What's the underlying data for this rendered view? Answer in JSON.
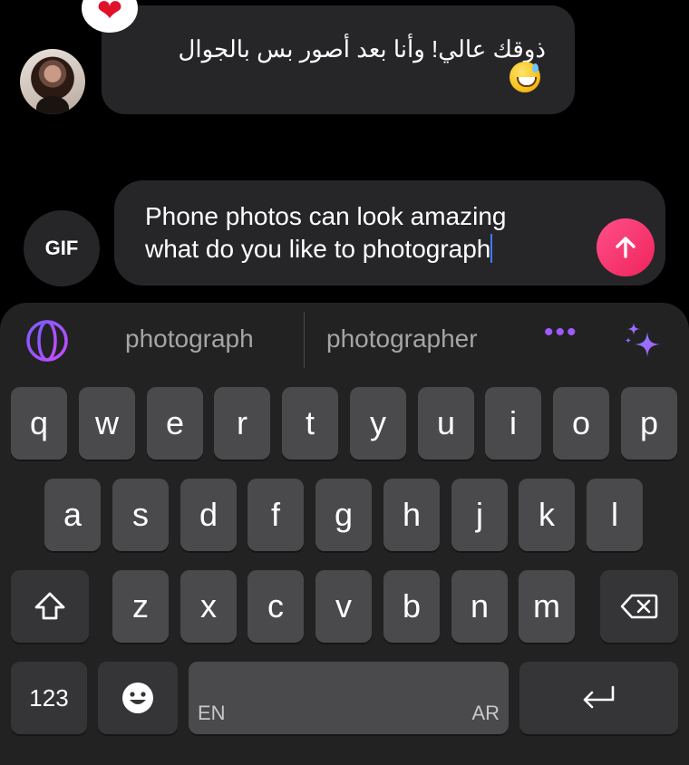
{
  "chat": {
    "incoming_message": "ذوقك عالي! وأنا بعد أصور بس بالجوال",
    "reaction": "heart",
    "emoji": "sweat-smile-emoji"
  },
  "composer": {
    "gif_label": "GIF",
    "line1": "Phone photos can look amazing",
    "line2": "what do you like to photograph"
  },
  "suggestions": {
    "items": [
      "photograph",
      "photographer"
    ],
    "more": "•••"
  },
  "keyboard": {
    "row1": [
      "q",
      "w",
      "e",
      "r",
      "t",
      "y",
      "u",
      "i",
      "o",
      "p"
    ],
    "row2": [
      "a",
      "s",
      "d",
      "f",
      "g",
      "h",
      "j",
      "k",
      "l"
    ],
    "row3": [
      "z",
      "x",
      "c",
      "v",
      "b",
      "n",
      "m"
    ],
    "numbers_label": "123",
    "space_left_lang": "EN",
    "space_right_lang": "AR"
  },
  "colors": {
    "send_button": "#f0245a",
    "accent_purple": "#a259ff",
    "caret": "#3d7cff"
  }
}
